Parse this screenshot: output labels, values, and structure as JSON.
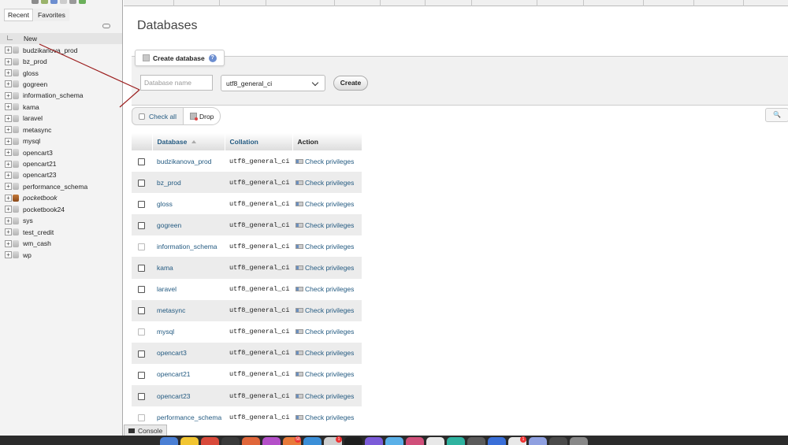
{
  "sidebar": {
    "tabs": [
      {
        "label": "Recent"
      },
      {
        "label": "Favorites"
      }
    ],
    "new_label": "New",
    "databases": [
      {
        "name": "budzikanova_prod"
      },
      {
        "name": "bz_prod"
      },
      {
        "name": "gloss"
      },
      {
        "name": "gogreen"
      },
      {
        "name": "information_schema"
      },
      {
        "name": "kama"
      },
      {
        "name": "laravel"
      },
      {
        "name": "metasync"
      },
      {
        "name": "mysql"
      },
      {
        "name": "opencart3"
      },
      {
        "name": "opencart21"
      },
      {
        "name": "opencart23"
      },
      {
        "name": "performance_schema"
      },
      {
        "name": "pocketbook",
        "italic": true
      },
      {
        "name": "pocketbook24"
      },
      {
        "name": "sys"
      },
      {
        "name": "test_credit"
      },
      {
        "name": "wm_cash"
      },
      {
        "name": "wp"
      }
    ]
  },
  "main": {
    "title": "Databases",
    "create": {
      "legend": "Create database",
      "name_placeholder": "Database name",
      "name_value": "",
      "collation": "utf8_general_ci",
      "button": "Create"
    },
    "toolbar": {
      "check_all": "Check all",
      "drop": "Drop"
    },
    "table": {
      "headers": {
        "database": "Database",
        "collation": "Collation",
        "action": "Action"
      },
      "action_label": "Check privileges",
      "rows": [
        {
          "database": "budzikanova_prod",
          "collation": "utf8_general_ci"
        },
        {
          "database": "bz_prod",
          "collation": "utf8_general_ci"
        },
        {
          "database": "gloss",
          "collation": "utf8_general_ci"
        },
        {
          "database": "gogreen",
          "collation": "utf8_general_ci"
        },
        {
          "database": "information_schema",
          "collation": "utf8_general_ci",
          "system": true
        },
        {
          "database": "kama",
          "collation": "utf8_general_ci"
        },
        {
          "database": "laravel",
          "collation": "utf8_general_ci"
        },
        {
          "database": "metasync",
          "collation": "utf8_general_ci"
        },
        {
          "database": "mysql",
          "collation": "utf8_general_ci",
          "system": true
        },
        {
          "database": "opencart3",
          "collation": "utf8_general_ci"
        },
        {
          "database": "opencart21",
          "collation": "utf8_general_ci"
        },
        {
          "database": "opencart23",
          "collation": "utf8_general_ci"
        },
        {
          "database": "performance_schema",
          "collation": "utf8_general_ci",
          "system": true
        }
      ]
    }
  },
  "console": {
    "label": "Console"
  },
  "dock": {
    "apps": [
      {
        "color": "#4a7fd4"
      },
      {
        "color": "#f2c531"
      },
      {
        "color": "#d94a3a"
      },
      {
        "color": "#3a3a3a"
      },
      {
        "color": "#e0663a"
      },
      {
        "color": "#b44fc8"
      },
      {
        "color": "#e87a3a",
        "badge": "58"
      },
      {
        "color": "#3b8fd8"
      },
      {
        "color": "#cfcfcf",
        "badge": "1"
      },
      {
        "color": "#1e1e1e"
      },
      {
        "color": "#7b5bd8"
      },
      {
        "color": "#5ab0e8"
      },
      {
        "color": "#d04f7a"
      },
      {
        "color": "#e8e8e8"
      },
      {
        "color": "#2fb3a0"
      },
      {
        "color": "#5b5b5b"
      },
      {
        "color": "#3a6fd8"
      },
      {
        "color": "#e8e8e8",
        "badge": "1"
      },
      {
        "color": "#8fa0e0"
      },
      {
        "color": "#4a4a4a"
      },
      {
        "color": "#888888"
      }
    ]
  }
}
